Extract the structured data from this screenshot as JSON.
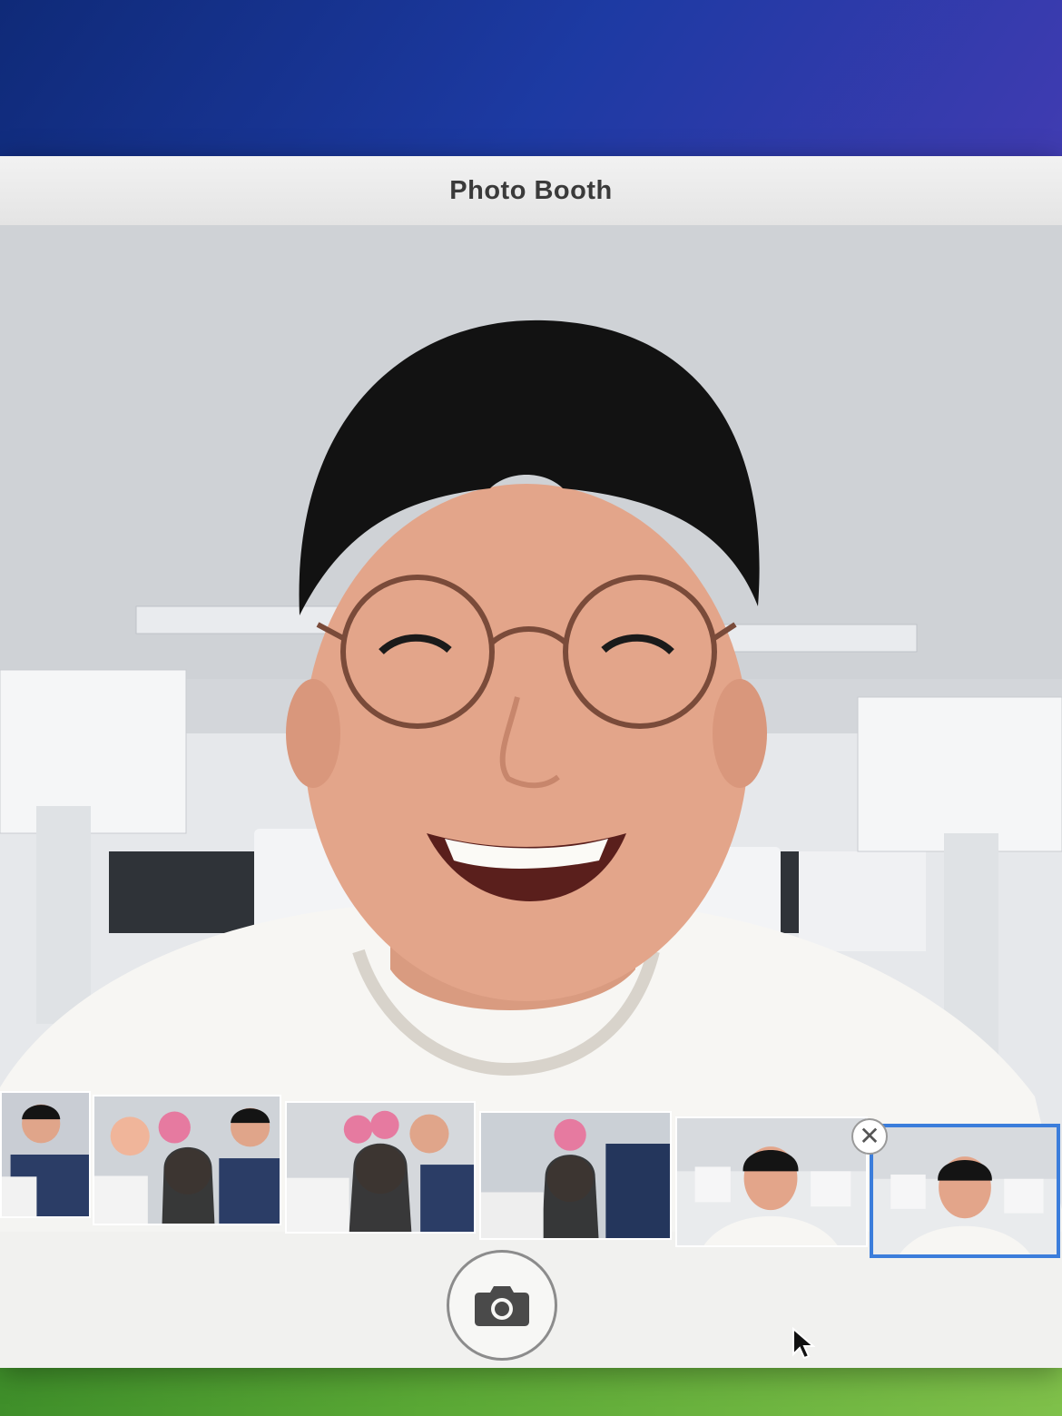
{
  "window": {
    "title": "Photo Booth"
  },
  "filmstrip": {
    "thumbnails": [
      {
        "subject": "group-photo"
      },
      {
        "subject": "group-photo"
      },
      {
        "subject": "group-photo"
      },
      {
        "subject": "group-photo"
      },
      {
        "subject": "portrait"
      },
      {
        "subject": "portrait",
        "selected": true
      }
    ]
  },
  "icons": {
    "delete": "close-icon",
    "shutter": "camera-icon",
    "pointer": "arrow-cursor-icon"
  },
  "colors": {
    "selection": "#3b7ddb",
    "window_background": "#f4f4f2"
  }
}
